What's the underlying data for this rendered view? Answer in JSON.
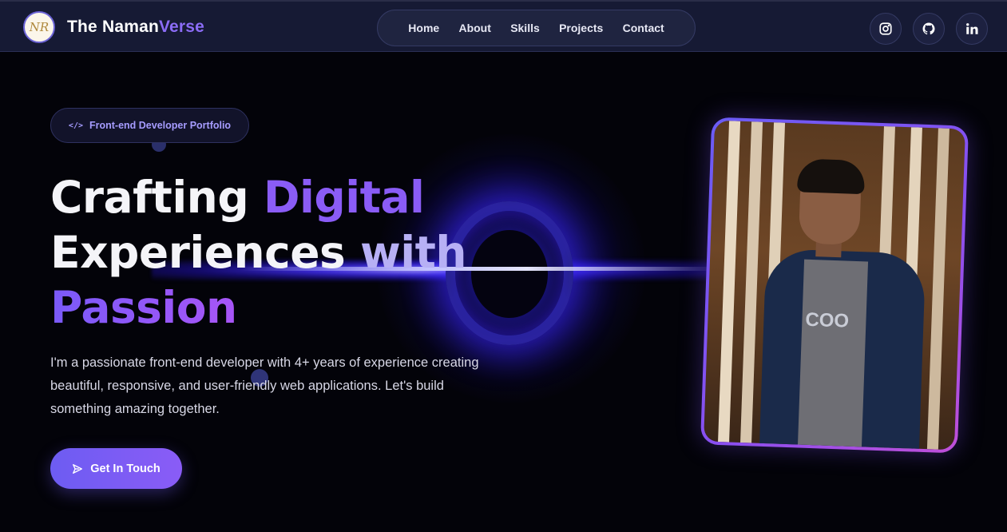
{
  "brand": {
    "logo_text": "NR",
    "name_part1": "The Naman",
    "name_part2": "Verse"
  },
  "nav": {
    "items": [
      "Home",
      "About",
      "Skills",
      "Projects",
      "Contact"
    ]
  },
  "social": [
    {
      "icon": "instagram-icon"
    },
    {
      "icon": "github-icon"
    },
    {
      "icon": "linkedin-icon"
    }
  ],
  "hero": {
    "badge_icon": "</>",
    "badge": "Front-end Developer Portfolio",
    "title": {
      "w1": "Crafting",
      "w2": "Digital",
      "w3": "Experiences",
      "w4": "with",
      "w5": "Passion"
    },
    "description": "I'm a passionate front-end developer with 4+ years of experience creating beautiful, responsive, and user-friendly web applications. Let's build something amazing together.",
    "cta": "Get In Touch",
    "photo_text": "COO"
  },
  "colors": {
    "accent": "#8a5cf6",
    "background": "#030309",
    "nav": "#161a34"
  }
}
